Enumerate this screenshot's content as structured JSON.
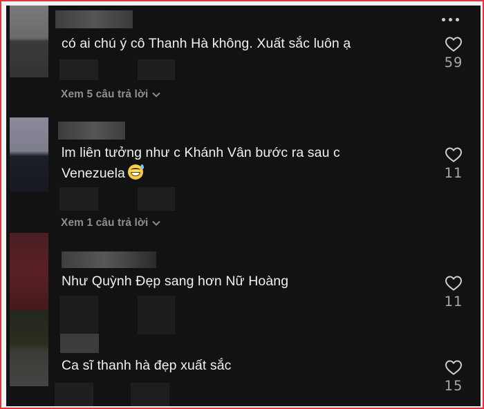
{
  "menu_icon": "more-horizontal-icon",
  "like_icon": "heart-outline-icon",
  "reply_toggle_icon": "chevron-down-icon",
  "colors": {
    "background": "#121212",
    "text": "#f1f1f1",
    "muted": "#8f8f8f",
    "frame_border": "#e0343f"
  },
  "comments": [
    {
      "text": "có ai chú ý cô Thanh Hà không. Xuất sắc luôn ạ",
      "like_count": "59",
      "replies_label": "Xem 5 câu trả lời"
    },
    {
      "text_line1": "lm liên tưởng như c Khánh Vân bước ra sau c",
      "text_line2": "Venezuela",
      "emoji": "grinning-face-with-sweat",
      "like_count": "11",
      "replies_label": "Xem 1 câu trả lời"
    },
    {
      "text": "Như Quỳnh Đẹp sang hơn Nữ Hoàng",
      "like_count": "11"
    },
    {
      "text": "Ca sĩ thanh hà đẹp xuất sắc",
      "like_count": "15"
    }
  ]
}
